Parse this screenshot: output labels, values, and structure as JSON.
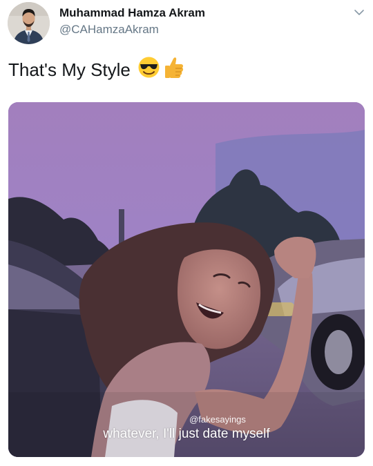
{
  "author": {
    "display_name": "Muhammad Hamza Akram",
    "handle": "@CAHamzaAkram"
  },
  "tweet": {
    "text": "That's My Style",
    "emojis": [
      "smiling-face-with-sunglasses-icon",
      "thumbs-up-icon"
    ]
  },
  "media": {
    "watermark": "@fakesayings",
    "subtitle": "whatever, I'll just date myself"
  },
  "colors": {
    "name_text": "#14171a",
    "handle_text": "#657786",
    "media_tint": "#8c75b8"
  }
}
